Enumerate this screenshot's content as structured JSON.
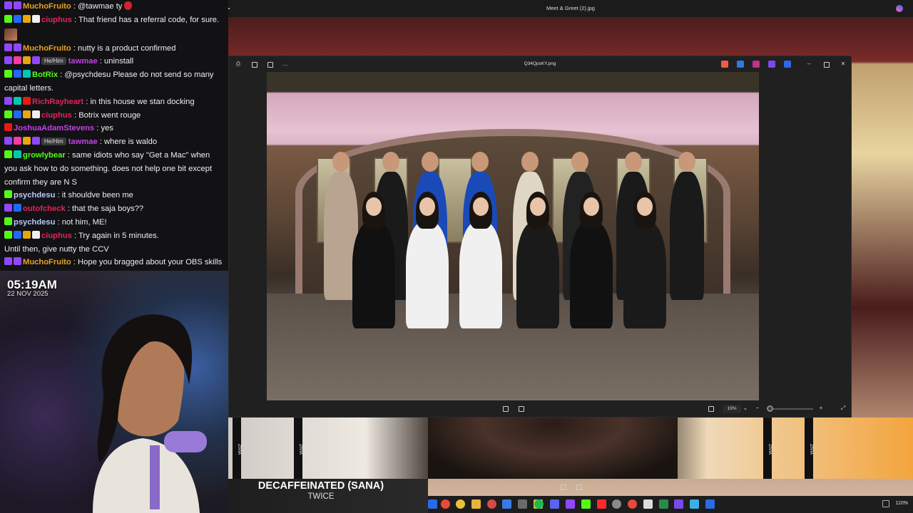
{
  "chat": {
    "messages": [
      {
        "user": "MuchoFruito",
        "color": "#e6a32b",
        "badges": [
          "purple",
          "purple"
        ],
        "pill": "",
        "text": ": @tawmae ty",
        "emoji": "strawberry"
      },
      {
        "user": "ciuphus",
        "color": "#e0245e",
        "badges": [
          "green",
          "blue",
          "gold",
          "white"
        ],
        "pill": "",
        "text": ": That friend has a referral code, for sure."
      },
      {
        "user": "",
        "emote_only": true
      },
      {
        "user": "MuchoFruito",
        "color": "#e6a32b",
        "badges": [
          "purple",
          "purple"
        ],
        "pill": "",
        "text": ": nutty is a product confirmed"
      },
      {
        "user": "tawmae",
        "color": "#c440e8",
        "badges": [
          "purple",
          "pink",
          "gold",
          "purple"
        ],
        "pill": "He/Him",
        "text": ": uninstall"
      },
      {
        "user": "BotRix",
        "color": "#53fc18",
        "badges": [
          "green",
          "blue",
          "teal"
        ],
        "pill": "",
        "text": ": @psychdesu Please do not send so many capital letters."
      },
      {
        "user": "RichRayheart",
        "color": "#e0245e",
        "badges": [
          "purple",
          "teal",
          "red"
        ],
        "pill": "",
        "text": ": in this house we stan docking"
      },
      {
        "user": "ciuphus",
        "color": "#e0245e",
        "badges": [
          "green",
          "blue",
          "gold",
          "white"
        ],
        "pill": "",
        "text": ": Botrix went rouge"
      },
      {
        "user": "JoshuaAdamStevens",
        "color": "#c440e8",
        "badges": [
          "red"
        ],
        "pill": "",
        "text": ": yes"
      },
      {
        "user": "tawmae",
        "color": "#c440e8",
        "badges": [
          "purple",
          "pink",
          "gold",
          "purple"
        ],
        "pill": "He/Him",
        "text": ": where is waldo"
      },
      {
        "user": "growlybear",
        "color": "#53fc18",
        "badges": [
          "green",
          "teal"
        ],
        "pill": "",
        "text": ": same idiots who say \"Get a Mac\" when you ask how to do something. does not help one bit except confirm they are N S"
      },
      {
        "user": "psychdesu",
        "color": "#b8c8ff",
        "badges": [
          "green"
        ],
        "pill": "",
        "text": ": it shouldve been me"
      },
      {
        "user": "outofcheck",
        "color": "#e0245e",
        "badges": [
          "purple",
          "blue"
        ],
        "pill": "",
        "text": ": that the saja boys??"
      },
      {
        "user": "psychdesu",
        "color": "#b8c8ff",
        "badges": [
          "green"
        ],
        "pill": "",
        "text": ": not him, ME!"
      },
      {
        "user": "ciuphus",
        "color": "#e0245e",
        "badges": [
          "green",
          "blue",
          "gold",
          "white"
        ],
        "pill": "",
        "text": ": Try again in 5 minutes."
      },
      {
        "user": "",
        "plain": true,
        "text": "Until then, give nutty the CCV"
      },
      {
        "user": "MuchoFruito",
        "color": "#e6a32b",
        "badges": [
          "purple",
          "purple"
        ],
        "pill": "",
        "text": ": Hope you bragged about your OBS skills to them"
      }
    ]
  },
  "webcam": {
    "time": "05:19AM",
    "date": "22 NOV 2025"
  },
  "outer_window": {
    "title": "Meet & Greet (2).jpg"
  },
  "viewer": {
    "title": "Q34QpsKY.png",
    "zoom": "19%"
  },
  "banner": {
    "lanyard_text": "ZIVIA"
  },
  "now_playing": {
    "title": "DECAFFEINATED (SANA)",
    "artist": "TWICE"
  },
  "taskbar": {
    "zoom": "110%"
  },
  "colors": {
    "chat_bg": "#121214",
    "accent_purple": "#9146ff",
    "kick_green": "#53fc18",
    "taskbar_bg": "#1d1d1d"
  }
}
